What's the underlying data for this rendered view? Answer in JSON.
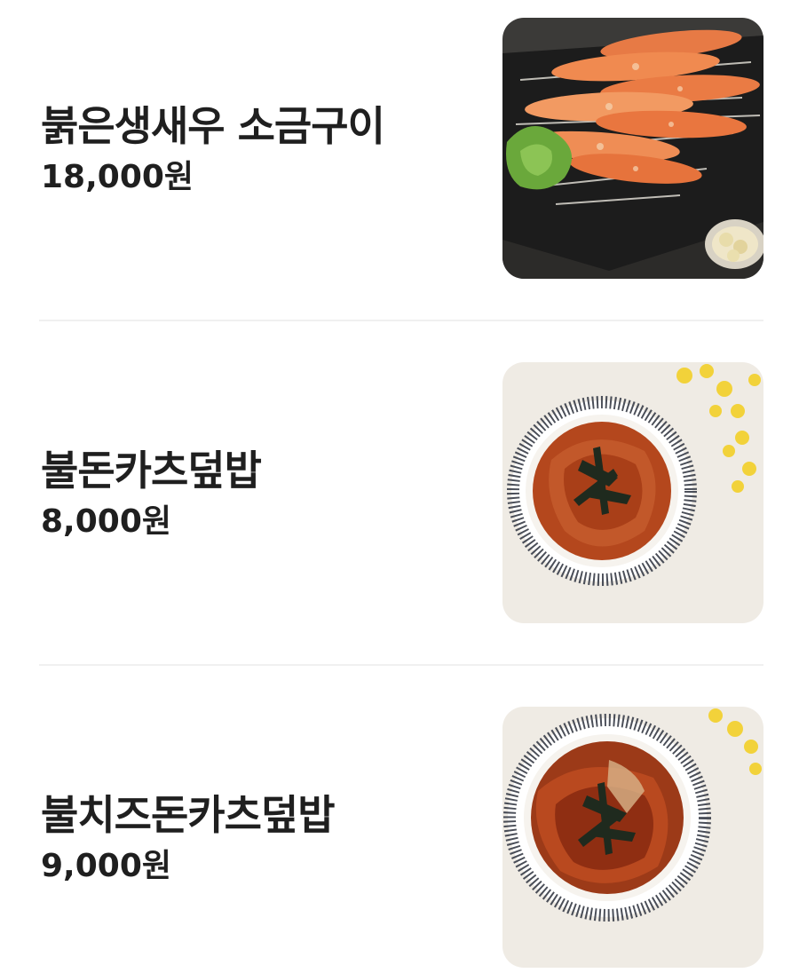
{
  "menu": {
    "items": [
      {
        "name": "붉은생새우 소금구이",
        "price": "18,000원",
        "image": "grilled-shrimp-photo"
      },
      {
        "name": "불돈카츠덮밥",
        "price": "8,000원",
        "image": "pork-cutlet-rice-bowl-photo"
      },
      {
        "name": "불치즈돈카츠덮밥",
        "price": "9,000원",
        "image": "cheese-pork-cutlet-rice-bowl-photo"
      }
    ]
  }
}
